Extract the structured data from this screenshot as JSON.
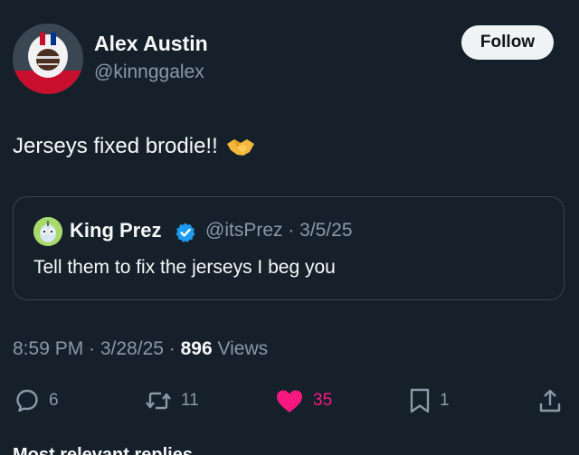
{
  "author": {
    "name": "Alex Austin",
    "handle": "@kinnggalex",
    "avatar_icon": "football-player-avatar"
  },
  "follow_label": "Follow",
  "tweet": {
    "text": "Jerseys fixed brodie!!",
    "emoji": "handshake-emoji"
  },
  "quote": {
    "name": "King Prez",
    "verified": true,
    "handle_date": "@itsPrez · 3/5/25",
    "text": "Tell them to fix the jerseys I beg you"
  },
  "meta": {
    "timestamp": "8:59 PM · 3/28/25 · ",
    "views_count": "896",
    "views_label": " Views"
  },
  "actions": {
    "replies": "6",
    "reposts": "11",
    "likes": "35",
    "bookmarks": "1"
  },
  "next_section_partial": "Most relevant replies",
  "colors": {
    "background": "#15202b",
    "like": "#f91880",
    "verified": "#1d9bf0",
    "muted": "#8b98a5"
  }
}
